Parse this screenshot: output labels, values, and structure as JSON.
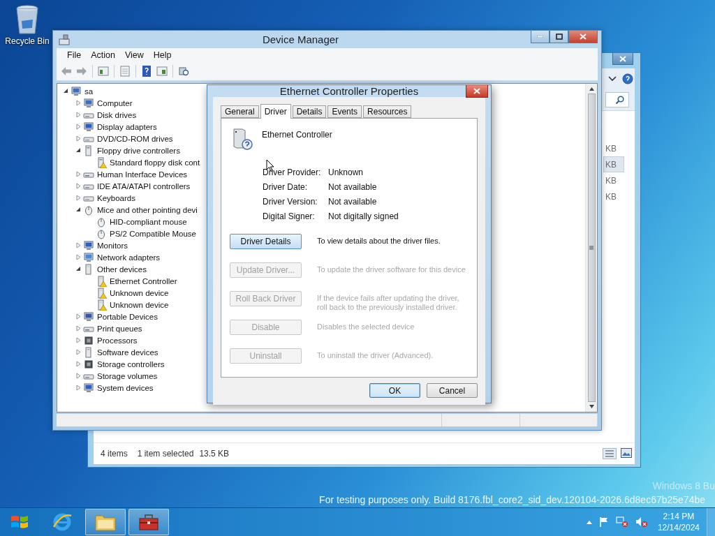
{
  "desktop_icons": [
    {
      "label": "Recycle Bin"
    }
  ],
  "explorer_window": {
    "sizes": [
      {
        "text": "KB",
        "selected": false
      },
      {
        "text": "KB",
        "selected": true
      },
      {
        "text": "KB",
        "selected": false
      },
      {
        "text": "KB",
        "selected": false
      }
    ],
    "status": [
      "4 items",
      "1 item selected",
      "13.5 KB"
    ]
  },
  "device_manager": {
    "title": "Device Manager",
    "menu": [
      "File",
      "Action",
      "View",
      "Help"
    ],
    "tree": {
      "label": "sa",
      "kind": "computer",
      "expanded": true,
      "children": [
        {
          "label": "Computer",
          "kind": "computer",
          "expanded": false
        },
        {
          "label": "Disk drives",
          "kind": "disk",
          "expanded": false
        },
        {
          "label": "Display adapters",
          "kind": "display",
          "expanded": false
        },
        {
          "label": "DVD/CD-ROM drives",
          "kind": "dvd",
          "expanded": false
        },
        {
          "label": "Floppy drive controllers",
          "kind": "floppy",
          "expanded": true,
          "children": [
            {
              "label": "Standard floppy disk cont",
              "kind": "floppy",
              "warning": true
            }
          ]
        },
        {
          "label": "Human Interface Devices",
          "kind": "hid",
          "expanded": false
        },
        {
          "label": "IDE ATA/ATAPI controllers",
          "kind": "ide",
          "expanded": false
        },
        {
          "label": "Keyboards",
          "kind": "keyboard",
          "expanded": false
        },
        {
          "label": "Mice and other pointing devi",
          "kind": "mouse",
          "expanded": true,
          "children": [
            {
              "label": "HID-compliant mouse",
              "kind": "mouse",
              "warning": false
            },
            {
              "label": "PS/2 Compatible Mouse",
              "kind": "mouse",
              "warning": false
            }
          ]
        },
        {
          "label": "Monitors",
          "kind": "display",
          "expanded": false
        },
        {
          "label": "Network adapters",
          "kind": "network",
          "expanded": false
        },
        {
          "label": "Other devices",
          "kind": "unknown",
          "expanded": true,
          "children": [
            {
              "label": "Ethernet Controller",
              "kind": "unknown",
              "warning": true
            },
            {
              "label": "Unknown device",
              "kind": "unknown",
              "warning": true
            },
            {
              "label": "Unknown device",
              "kind": "unknown",
              "warning": true
            }
          ]
        },
        {
          "label": "Portable Devices",
          "kind": "portable",
          "expanded": false
        },
        {
          "label": "Print queues",
          "kind": "printer",
          "expanded": false
        },
        {
          "label": "Processors",
          "kind": "cpu",
          "expanded": false
        },
        {
          "label": "Software devices",
          "kind": "software",
          "expanded": false
        },
        {
          "label": "Storage controllers",
          "kind": "storage",
          "expanded": false
        },
        {
          "label": "Storage volumes",
          "kind": "disk",
          "expanded": false
        },
        {
          "label": "System devices",
          "kind": "display",
          "expanded": false
        }
      ]
    }
  },
  "dialog": {
    "title": "Ethernet Controller Properties",
    "tabs": [
      {
        "label": "General",
        "selected": false
      },
      {
        "label": "Driver",
        "selected": true
      },
      {
        "label": "Details",
        "selected": false
      },
      {
        "label": "Events",
        "selected": false
      },
      {
        "label": "Resources",
        "selected": false
      }
    ],
    "device_name": "Ethernet Controller",
    "fields": [
      {
        "label": "Driver Provider:",
        "value": "Unknown"
      },
      {
        "label": "Driver Date:",
        "value": "Not available"
      },
      {
        "label": "Driver Version:",
        "value": "Not available"
      },
      {
        "label": "Digital Signer:",
        "value": "Not digitally signed"
      }
    ],
    "actions": [
      {
        "button": "Driver Details",
        "description": "To view details about the driver files.",
        "disabled": false
      },
      {
        "button": "Update Driver...",
        "description": "To update the driver software for this device",
        "disabled": true
      },
      {
        "button": "Roll Back Driver",
        "description": "If the device fails after updating the driver, roll back to the previously installed driver.",
        "disabled": true
      },
      {
        "button": "Disable",
        "description": "Disables the selected device",
        "disabled": true
      },
      {
        "button": "Uninstall",
        "description": "To uninstall the driver (Advanced).",
        "disabled": true
      }
    ],
    "buttons": [
      {
        "label": "OK",
        "default": true
      },
      {
        "label": "Cancel",
        "default": false
      }
    ]
  },
  "desktop_text": [
    "Windows 8 Bu",
    "For testing purposes only. Build 8176.fbl_core2_sid_dev.120104-2026.6d8ec67b25e74be"
  ],
  "taskbar": {
    "apps": [
      {
        "kind": "browser",
        "active": false
      },
      {
        "kind": "folder",
        "active": true
      },
      {
        "kind": "toolbox",
        "active": true
      }
    ],
    "time": "2:14 PM",
    "date": "12/14/2024"
  }
}
